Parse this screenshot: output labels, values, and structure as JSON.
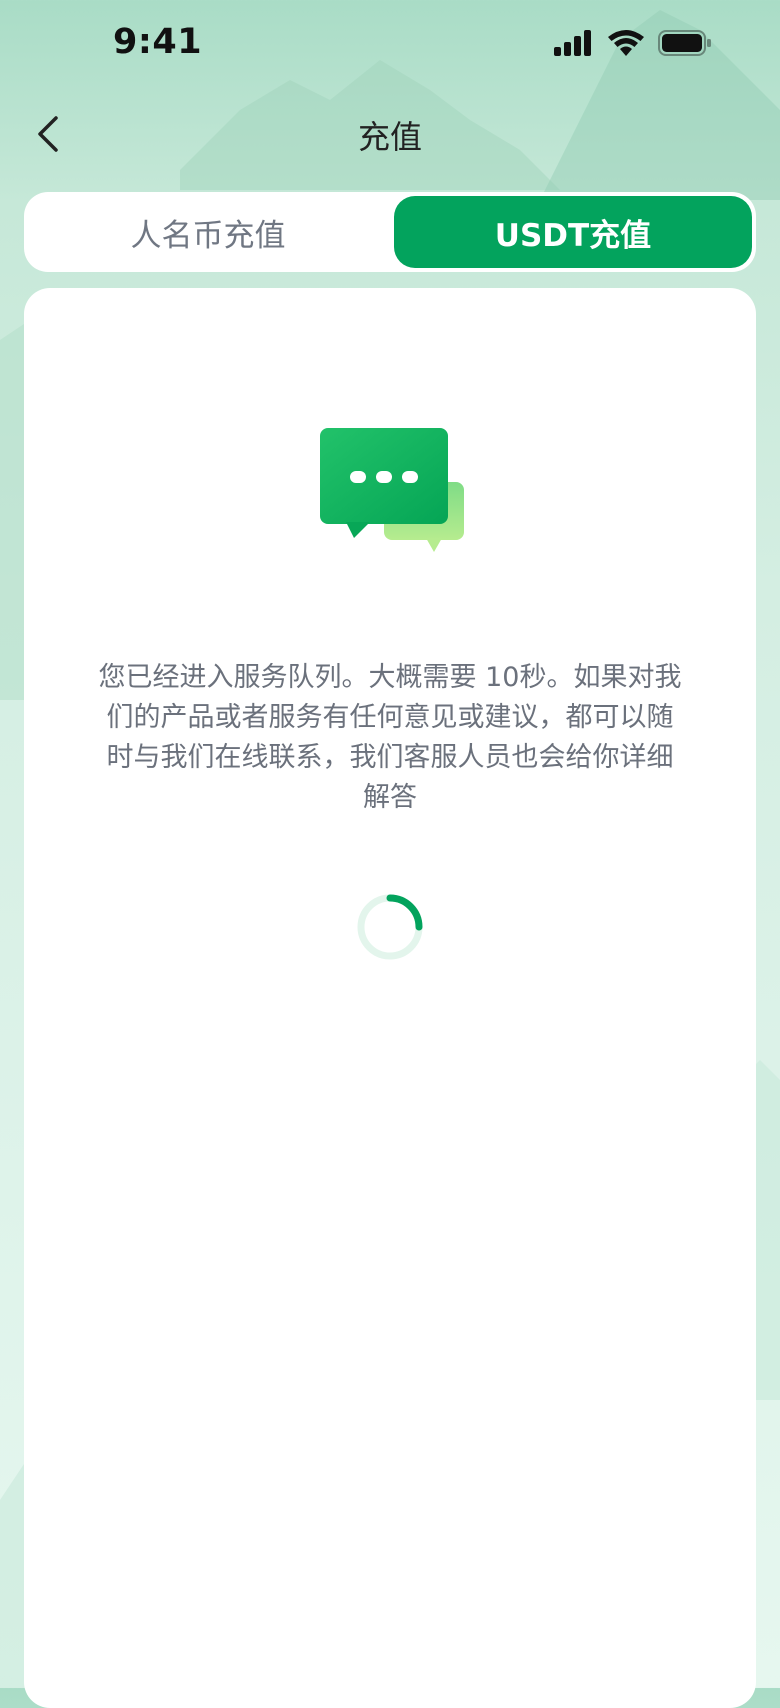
{
  "status_bar": {
    "time": "9:41"
  },
  "nav": {
    "title": "充值",
    "back_icon": "chevron-left-icon"
  },
  "tabs": [
    {
      "label": "人名币充值",
      "active": false
    },
    {
      "label": "USDT充值",
      "active": true
    }
  ],
  "queue": {
    "message": "您已经进入服务队列。大概需要 10秒。如果对我们的产品或者服务有任何意见或建议，都可以随时与我们在线联系，我们客服人员也会给你详细解答",
    "illustration_icon": "chat-bubbles-icon",
    "loading_icon": "spinner-icon"
  },
  "colors": {
    "accent": "#03a35d",
    "background_top": "#a9dcc6",
    "background_bottom": "#e6f7ef",
    "text_secondary": "#6b717c"
  }
}
